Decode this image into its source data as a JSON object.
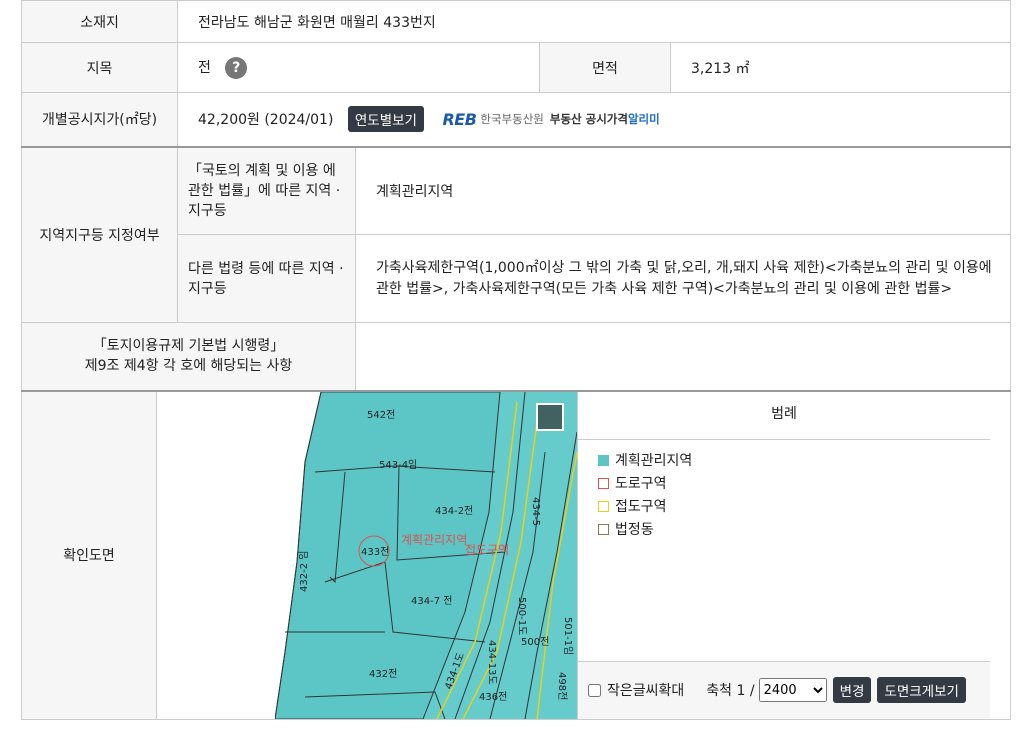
{
  "rows": {
    "location": {
      "label": "소재지",
      "value": "전라남도 해남군 화원면 매월리 433번지"
    },
    "jimok": {
      "label": "지목",
      "value": "전",
      "help_icon": "?"
    },
    "area": {
      "label": "면적",
      "value": "3,213 ㎡"
    },
    "price": {
      "label": "개별공시지가(㎡당)",
      "value": "42,200원 (2024/01)",
      "button": "연도별보기",
      "reb_mark": "REB",
      "reb_org": "한국부동산원",
      "reb_service_a": "부동산 공시가격",
      "reb_service_b": "알리미"
    },
    "zoning": {
      "label": "지역지구등 지정여부",
      "sub1_label": "「국토의 계획 및 이용 에 관한 법률」에 따른 지역 · 지구등",
      "sub1_value": "계획관리지역",
      "sub2_label": "다른 법령 등에 따른 지역 · 지구등",
      "sub2_value": "가축사육제한구역(1,000㎡이상 그 밖의 가축 및 닭,오리, 개,돼지 사육 제한)<가축분뇨의 관리 및 이용에 관한 법률>, 가축사육제한구역(모든 가축 사육 제한 구역)<가축분뇨의 관리 및 이용에 관한 법률>"
    },
    "regulation": {
      "label_line1": "「토지이용규제 기본법 시행령」",
      "label_line2": "제9조 제4항 각 호에 해당되는 사항",
      "value": ""
    },
    "map": {
      "label": "확인도면",
      "legend_title": "범례",
      "legend": [
        {
          "label": "계획관리지역",
          "color": "#5cc6c6",
          "style": "fill"
        },
        {
          "label": "도로구역",
          "color": "#d9534f",
          "style": "outline"
        },
        {
          "label": "접도구역",
          "color": "#e6d21a",
          "style": "outline"
        },
        {
          "label": "법정동",
          "color": "#8a7a55",
          "style": "outline"
        }
      ],
      "small_font_label": "작은글씨확대",
      "scale_label": "축척 1 /",
      "scale_value": "2400",
      "change_button": "변경",
      "bigger_button": "도면크게보기",
      "parcels": [
        "542전",
        "543-4임",
        "434-2전",
        "433전",
        "434-7 전",
        "432-2 임",
        "432전",
        "436전",
        "434-13도",
        "500-1도",
        "500전",
        "501-1임",
        "498전",
        "434-5",
        "434-1도"
      ],
      "zone_label_1": "계획관리지역",
      "zone_label_2": "접도구역"
    }
  }
}
